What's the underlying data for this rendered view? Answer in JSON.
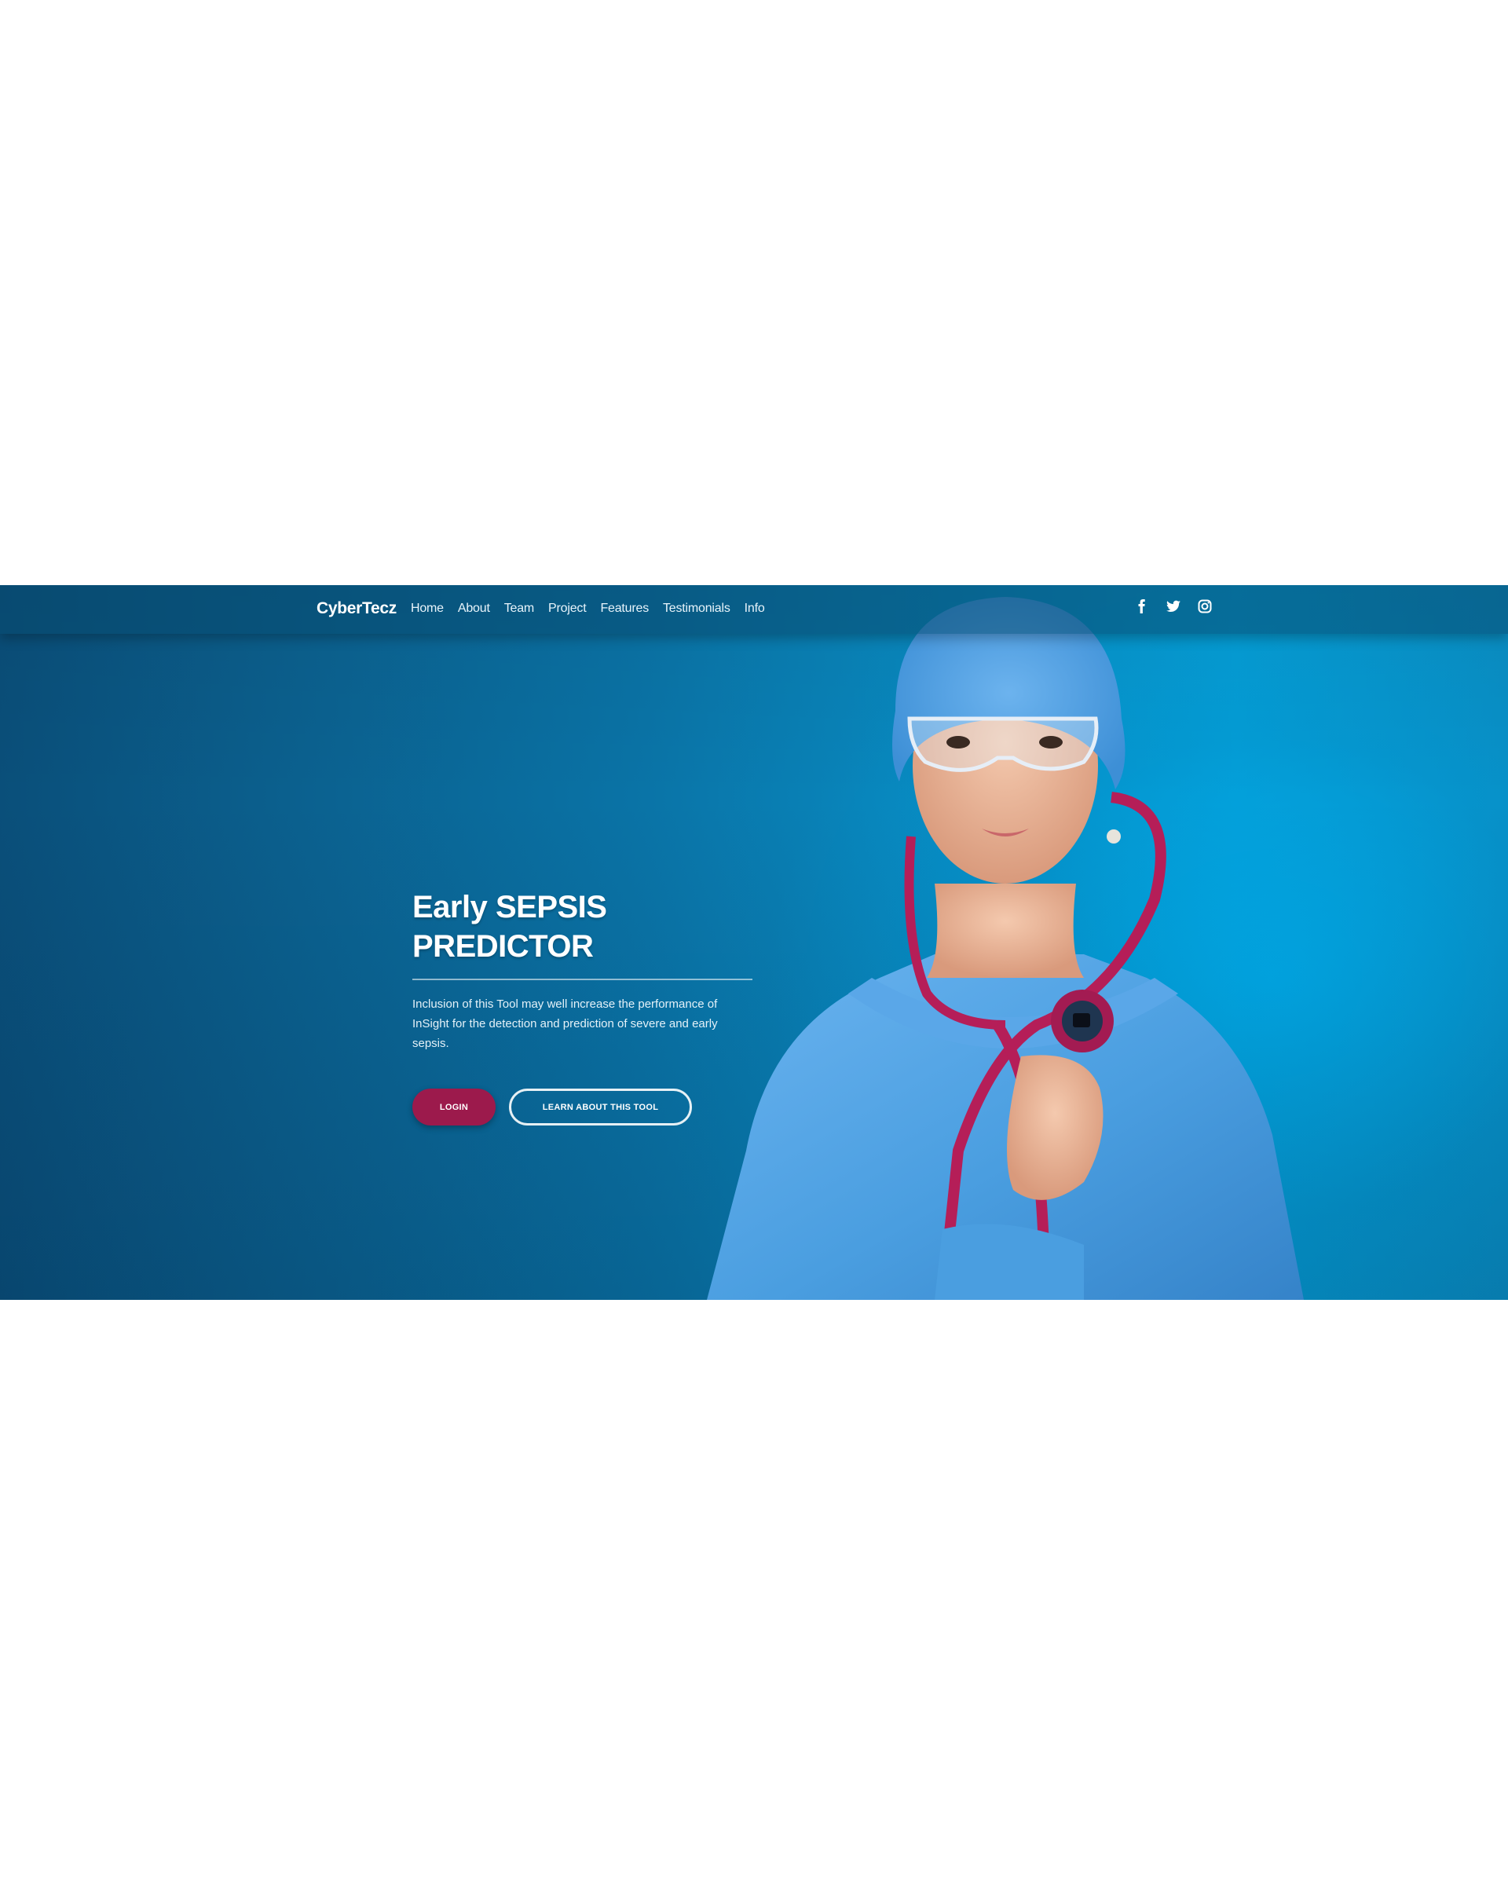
{
  "navbar": {
    "brand": "CyberTecz",
    "links": [
      "Home",
      "About",
      "Team",
      "Project",
      "Features",
      "Testimonials",
      "Info"
    ],
    "social": [
      "facebook-icon",
      "twitter-icon",
      "instagram-icon"
    ]
  },
  "hero": {
    "title_line1": "Early SEPSIS",
    "title_line2": "PREDICTOR",
    "description": "Inclusion of this Tool may well increase the performance of InSight for the detection and prediction of severe and early sepsis.",
    "login_label": "LOGIN",
    "learn_label": "LEARN ABOUT THIS TOOL"
  },
  "colors": {
    "accent": "#9c1a4c",
    "hero_blue": "#0a73a6",
    "scrubs": "#4a9ee0"
  }
}
